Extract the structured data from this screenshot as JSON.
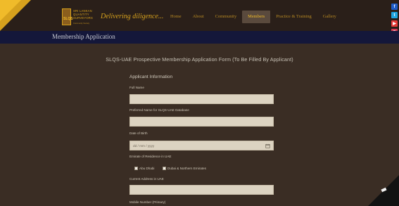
{
  "header": {
    "logo_text": [
      "SRI LANKAN",
      "QUANTITY",
      "SURVEYORS"
    ],
    "logo_acronym": "SLQS",
    "logo_subtext": "Community Society",
    "tagline": "Delivering diligence...",
    "nav": [
      {
        "label": "Home",
        "active": false
      },
      {
        "label": "About",
        "active": false
      },
      {
        "label": "Community",
        "active": false
      },
      {
        "label": "Members",
        "active": true
      },
      {
        "label": "Practice & Training",
        "active": false
      },
      {
        "label": "Gallery",
        "active": false
      }
    ],
    "social": [
      {
        "icon": "facebook-icon",
        "glyph": "f",
        "color": "#1e5cc9"
      },
      {
        "icon": "twitter-icon",
        "glyph": "🐦",
        "color": "#1fa4df"
      },
      {
        "icon": "youtube-icon",
        "glyph": "▶",
        "color": "#e53935"
      },
      {
        "icon": "instagram-icon",
        "glyph": "◎",
        "color": "#d93a55"
      }
    ]
  },
  "page": {
    "title": "Membership Application",
    "form_title": "SLQS-UAE Prospective Membership Application Form (To Be Filled By Applicant)"
  },
  "form": {
    "section": "Applicant Information",
    "full_name_label": "Full Name",
    "preferred_name_label": "Preferred Name for SLQS-UAE Database",
    "dob_label": "Date of Birth",
    "dob_placeholder": "dd / mm / yyyy",
    "emirate_label": "Emirate of Residence in UAE",
    "emirate_options": [
      "Abu Dhabi",
      "Dubai & Northern Emirates"
    ],
    "address_label": "Current Address in UAE",
    "mobile_label": "Mobile Number (Primary)"
  },
  "colors": {
    "background": "#3a2d24",
    "header": "#2a1f19",
    "accent": "#d6a11d",
    "titlebar": "#14173a",
    "input": "#dcd3c1"
  }
}
